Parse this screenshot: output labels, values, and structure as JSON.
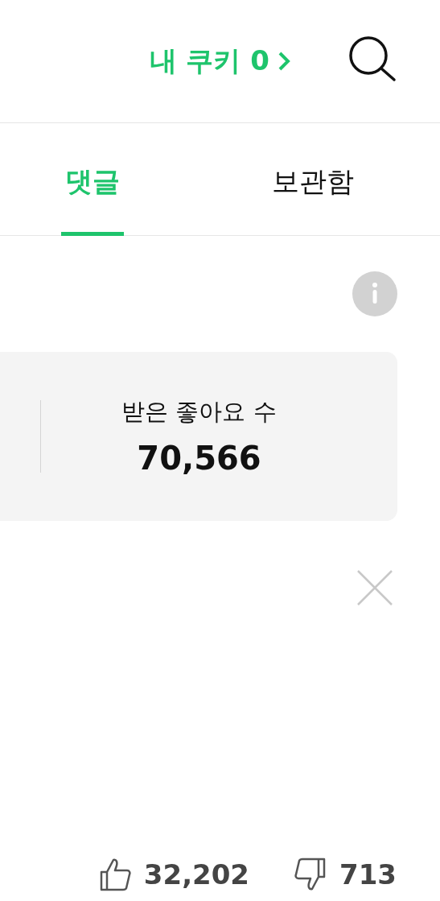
{
  "header": {
    "cookie_label": "내 쿠키 0"
  },
  "tabs": [
    {
      "label": "댓글",
      "selected": true
    },
    {
      "label": "보관함",
      "selected": false
    }
  ],
  "stats_card": {
    "label": "받은 좋아요 수",
    "value": "70,566"
  },
  "reactions": {
    "likes": "32,202",
    "dislikes": "713"
  }
}
